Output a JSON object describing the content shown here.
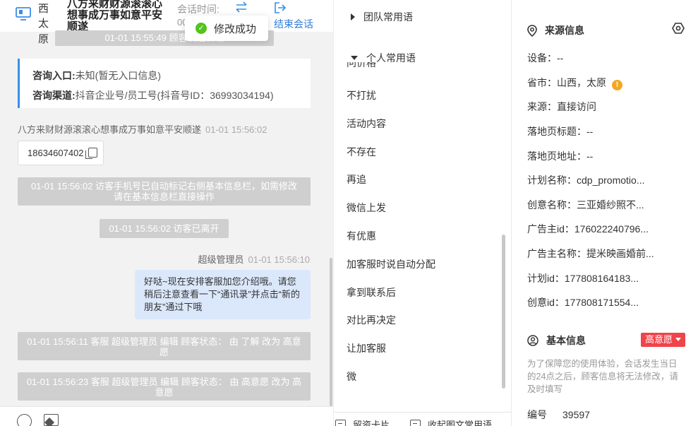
{
  "chat": {
    "header": {
      "location_lines": [
        "西",
        "太",
        "原"
      ],
      "visitor_name": "八方来财财源滚滚心想事成万事如意平安顺遂",
      "session_time_label": "会话时间:",
      "session_time_value": "00",
      "end_session_label": "结束会话"
    },
    "toast": {
      "text": "修改成功"
    },
    "system_start": "01-01 15:55:49 顾客发起会话",
    "entry": {
      "entry_key": "咨询入口:",
      "entry_value": "未知(暂无入口信息)",
      "channel_key": "咨询渠道:",
      "channel_value": "抖音企业号/员工号(抖音号ID：36993034194)"
    },
    "visitor_msg": {
      "sender": "八方来财财源滚滚心想事成万事如意平安顺遂",
      "time": "01-01 15:56:02",
      "phone": "18634607402"
    },
    "system_mark": "01-01 15:56:02 访客手机号已自动标记右侧基本信息栏，如需修改请在基本信息栏直接操作",
    "system_left": "01-01 15:56:02 访客已离开",
    "agent_msg": {
      "sender": "超级管理员",
      "time": "01-01 15:56:10",
      "text": "好哒~现在安排客服加您介绍哦。请您稍后注意查看一下“通讯录”并点击“新的朋友”通过下哦"
    },
    "system_edit1": "01-01 15:56:11 客服 超级管理员 编辑 顾客状态： 由 了解 改为 高意愿",
    "system_edit2": "01-01 15:56:23 客服 超级管理员 编辑 顾客状态： 由 高意愿 改为 高意愿"
  },
  "phrases": {
    "team_group": "团队常用语",
    "personal_group": "个人常用语",
    "cut_item": "问价格",
    "items": [
      "不打扰",
      "活动内容",
      "不存在",
      "再追",
      "微信上发",
      "有优惠",
      "加客服时说自动分配",
      "拿到联系后",
      "对比再决定",
      "让加客服",
      "微"
    ],
    "footer_card": "留资卡片",
    "footer_collapse": "收起图文常用语"
  },
  "info": {
    "source_title": "来源信息",
    "fields": [
      "设备：--",
      "省市：山西，太原",
      "来源：直接访问",
      "落地页标题：--",
      "落地页地址：--",
      "计划名称：cdp_promotio...",
      "创意名称：三亚婚纱照不...",
      "广告主id：176022240796...",
      "广告主名称：提米映画婚前...",
      "计划id：177808164183...",
      "创意id：177808171554..."
    ],
    "basic_title": "基本信息",
    "intent_badge": "高意愿",
    "notice": "为了保障您的使用体验，会话发生当日的24点之后，顾客信息将无法修改，请及时填写",
    "id_label": "编号",
    "id_value": "39597"
  },
  "colors": {
    "accent_blue": "#2f7cd8",
    "success_green": "#52c41a",
    "warning_orange": "#f5a623",
    "badge_red": "#f0434a",
    "agent_bubble": "#dbe8fb",
    "system_pill": "#cfcfcf"
  }
}
